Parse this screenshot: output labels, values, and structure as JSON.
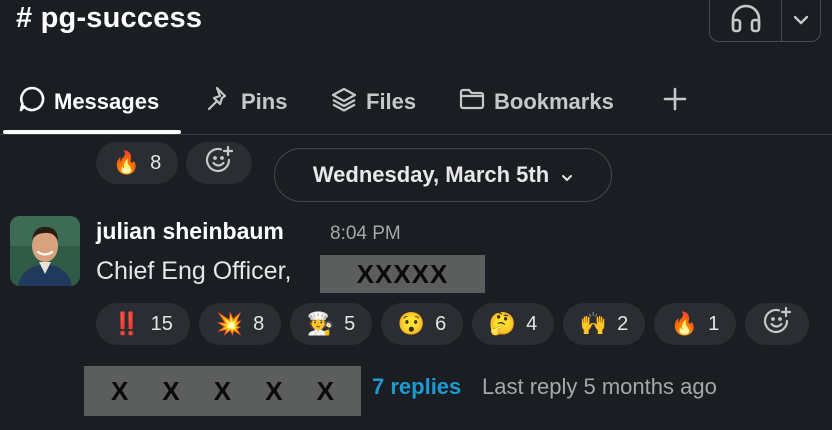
{
  "channel": {
    "hash": "#",
    "name": "pg-success"
  },
  "header": {
    "huddle_icon": "headphones-icon",
    "menu_icon": "chevron-down-icon"
  },
  "tabs": [
    {
      "label": "Messages",
      "icon": "chat-bubble-icon",
      "active": true
    },
    {
      "label": "Pins",
      "icon": "pin-icon",
      "active": false
    },
    {
      "label": "Files",
      "icon": "layers-icon",
      "active": false
    },
    {
      "label": "Bookmarks",
      "icon": "folder-icon",
      "active": false
    }
  ],
  "add_tab_icon": "plus-icon",
  "prev_message_reactions": [
    {
      "emoji": "🔥",
      "count": "8"
    }
  ],
  "date_divider": {
    "label": "Wednesday, March 5th"
  },
  "message": {
    "sender": "julian sheinbaum",
    "time": "8:04 PM",
    "text": "Chief Eng Officer,",
    "redacted_text": "XXXXX",
    "reactions": [
      {
        "emoji": "‼️",
        "count": "15"
      },
      {
        "emoji": "💥",
        "count": "8"
      },
      {
        "emoji": "🧑‍🍳",
        "count": "5"
      },
      {
        "emoji": "😯",
        "count": "6"
      },
      {
        "emoji": "🤔",
        "count": "4"
      },
      {
        "emoji": "🙌",
        "count": "2"
      },
      {
        "emoji": "🔥",
        "count": "1"
      }
    ],
    "thread": {
      "redacted_avatars": [
        "X",
        "X",
        "X",
        "X",
        "X"
      ],
      "replies": "7 replies",
      "last_reply": "Last reply 5 months ago"
    }
  },
  "colors": {
    "background": "#1a1d21",
    "pill": "#2a2d31",
    "link": "#1d9bd1",
    "redaction": "#5c5d5d"
  }
}
